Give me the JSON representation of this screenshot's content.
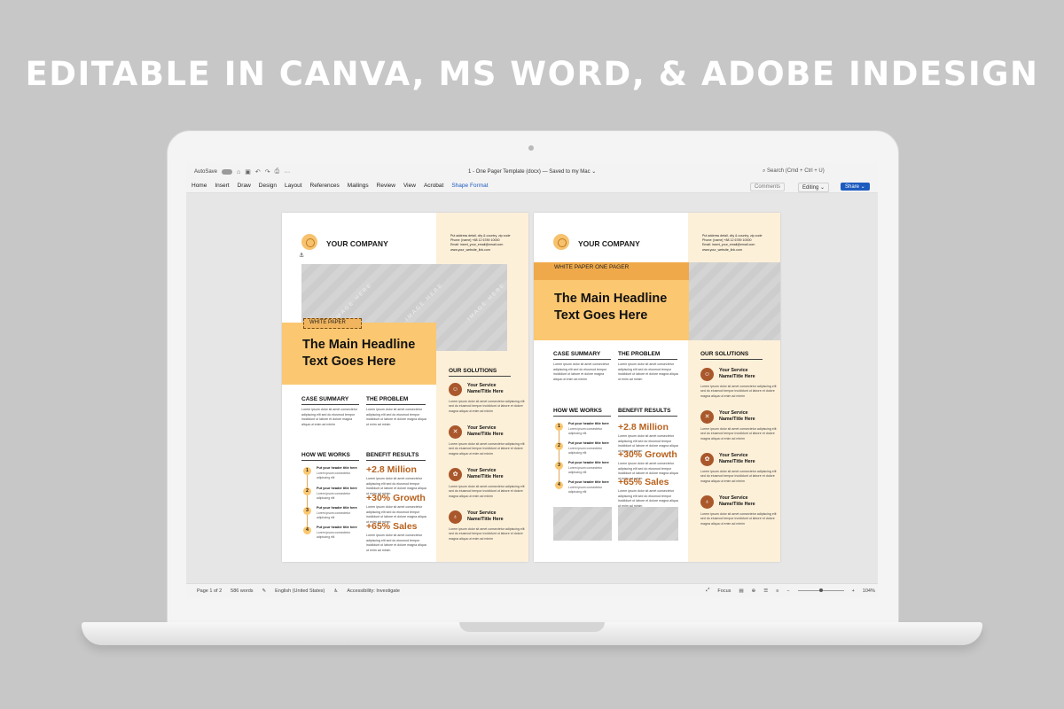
{
  "banner": "EDITABLE IN CANVA, MS WORD, & ADOBE INDESIGN",
  "word": {
    "autosave": "AutoSave",
    "doc_title": "1 - One Pager Template (docx) — Saved to my Mac ⌄",
    "search": "Search (Cmd + Ctrl + U)",
    "tabs": [
      "Home",
      "Insert",
      "Draw",
      "Design",
      "Layout",
      "References",
      "Mailings",
      "Review",
      "View",
      "Acrobat",
      "Shape Format"
    ],
    "comments": "Comments",
    "editing": "Editing ⌄",
    "share": "Share ⌄",
    "status": {
      "page": "Page 1 of 2",
      "words": "586 words",
      "language": "English (United States)",
      "accessibility": "Accessibility: Investigate",
      "focus": "Focus",
      "zoom": "104%",
      "minus": "−",
      "plus": "+"
    }
  },
  "page1": {
    "company": "YOUR COMPANY",
    "address": [
      "Put address detail, city & country, zip code",
      "Phone: [name] +88 12 6789 10000",
      "Email: insert_your_email@email.com",
      "www.your_website_link.com"
    ],
    "image_text": "IMAGE HERE",
    "white_paper": "WHITE PAPER",
    "headline": [
      "The Main Headline",
      "Text Goes Here"
    ],
    "case_summary": "CASE SUMMARY",
    "the_problem": "THE PROBLEM",
    "how_we_works": "HOW WE WORKS",
    "benefit_results": "BENEFIT RESULTS",
    "our_solutions": "OUR SOLUTIONS",
    "body_text": "Lorem ipsum dolor sit amet consectetur adipiscing elit sed do eiusmod tempor incididunt ut labore et dolore magna aliqua ut enim ad minim",
    "steps": [
      {
        "n": "1",
        "title": "Put your header title here",
        "text": "Lorem ipsum consectetur adipiscing elit"
      },
      {
        "n": "2",
        "title": "Put your header title here",
        "text": "Lorem ipsum consectetur adipiscing elit"
      },
      {
        "n": "3",
        "title": "Put your header title here",
        "text": "Lorem ipsum consectetur adipiscing elit"
      },
      {
        "n": "4",
        "title": "Put your header title here",
        "text": "Lorem ipsum consectetur adipiscing elit"
      }
    ],
    "stats": [
      "+2.8 Million",
      "+30% Growth",
      "+65% Sales"
    ],
    "services": [
      {
        "title": "Your Service Name/Title Here",
        "icon": "people-icon"
      },
      {
        "title": "Your Service Name/Title Here",
        "icon": "tools-icon"
      },
      {
        "title": "Your Service Name/Title Here",
        "icon": "plant-icon"
      },
      {
        "title": "Your Service Name/Title Here",
        "icon": "lightbulb-icon"
      }
    ]
  },
  "page2": {
    "company": "YOUR COMPANY",
    "white_paper_bar": "WHITE PAPER ONE PAGER",
    "headline": [
      "The Main Headline",
      "Text Goes Here"
    ],
    "case_summary": "CASE SUMMARY",
    "the_problem": "THE PROBLEM",
    "how_we_works": "HOW WE WORKS",
    "benefit_results": "BENEFIT RESULTS",
    "our_solutions": "OUR SOLUTIONS",
    "stats": [
      "+2.8 Million",
      "+30% Growth",
      "+65% Sales"
    ]
  },
  "colors": {
    "accent": "#fbc770",
    "accent_dark": "#b8621e",
    "icon_bg": "#a9572b",
    "panel": "#fdf0d9",
    "share": "#1e5bbf"
  }
}
